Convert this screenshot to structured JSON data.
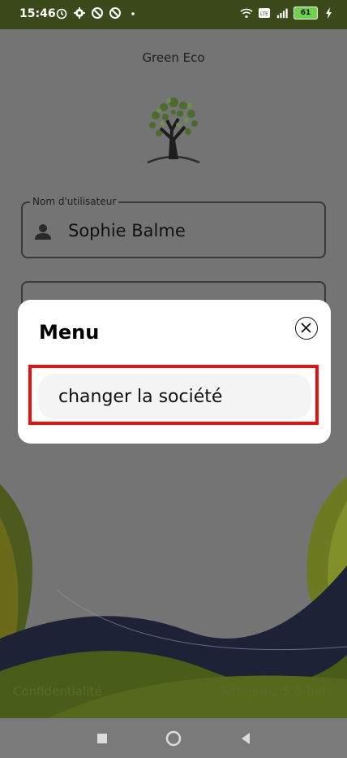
{
  "status": {
    "time": "15:46",
    "battery": "61",
    "icons_left": [
      "alarm-icon",
      "gear-icon",
      "dnd-icon",
      "dnd-icon",
      "dot-icon"
    ],
    "icons_right": [
      "wifi-icon",
      "volte-icon",
      "signal-icon",
      "battery-icon",
      "charging-icon"
    ]
  },
  "app": {
    "brand": "Green Eco",
    "username_label": "Nom d'utilisateur",
    "username_value": "Sophie Balme"
  },
  "dialog": {
    "title": "Menu",
    "items": [
      {
        "label": "changer la société"
      }
    ]
  },
  "footer": {
    "privacy": "Confidentialité",
    "version": "Altagem2.5.0-beta"
  },
  "colors": {
    "status_bar": "#3c4a1b",
    "highlight": "#e81010",
    "footer_text": "#5c6a2a"
  }
}
